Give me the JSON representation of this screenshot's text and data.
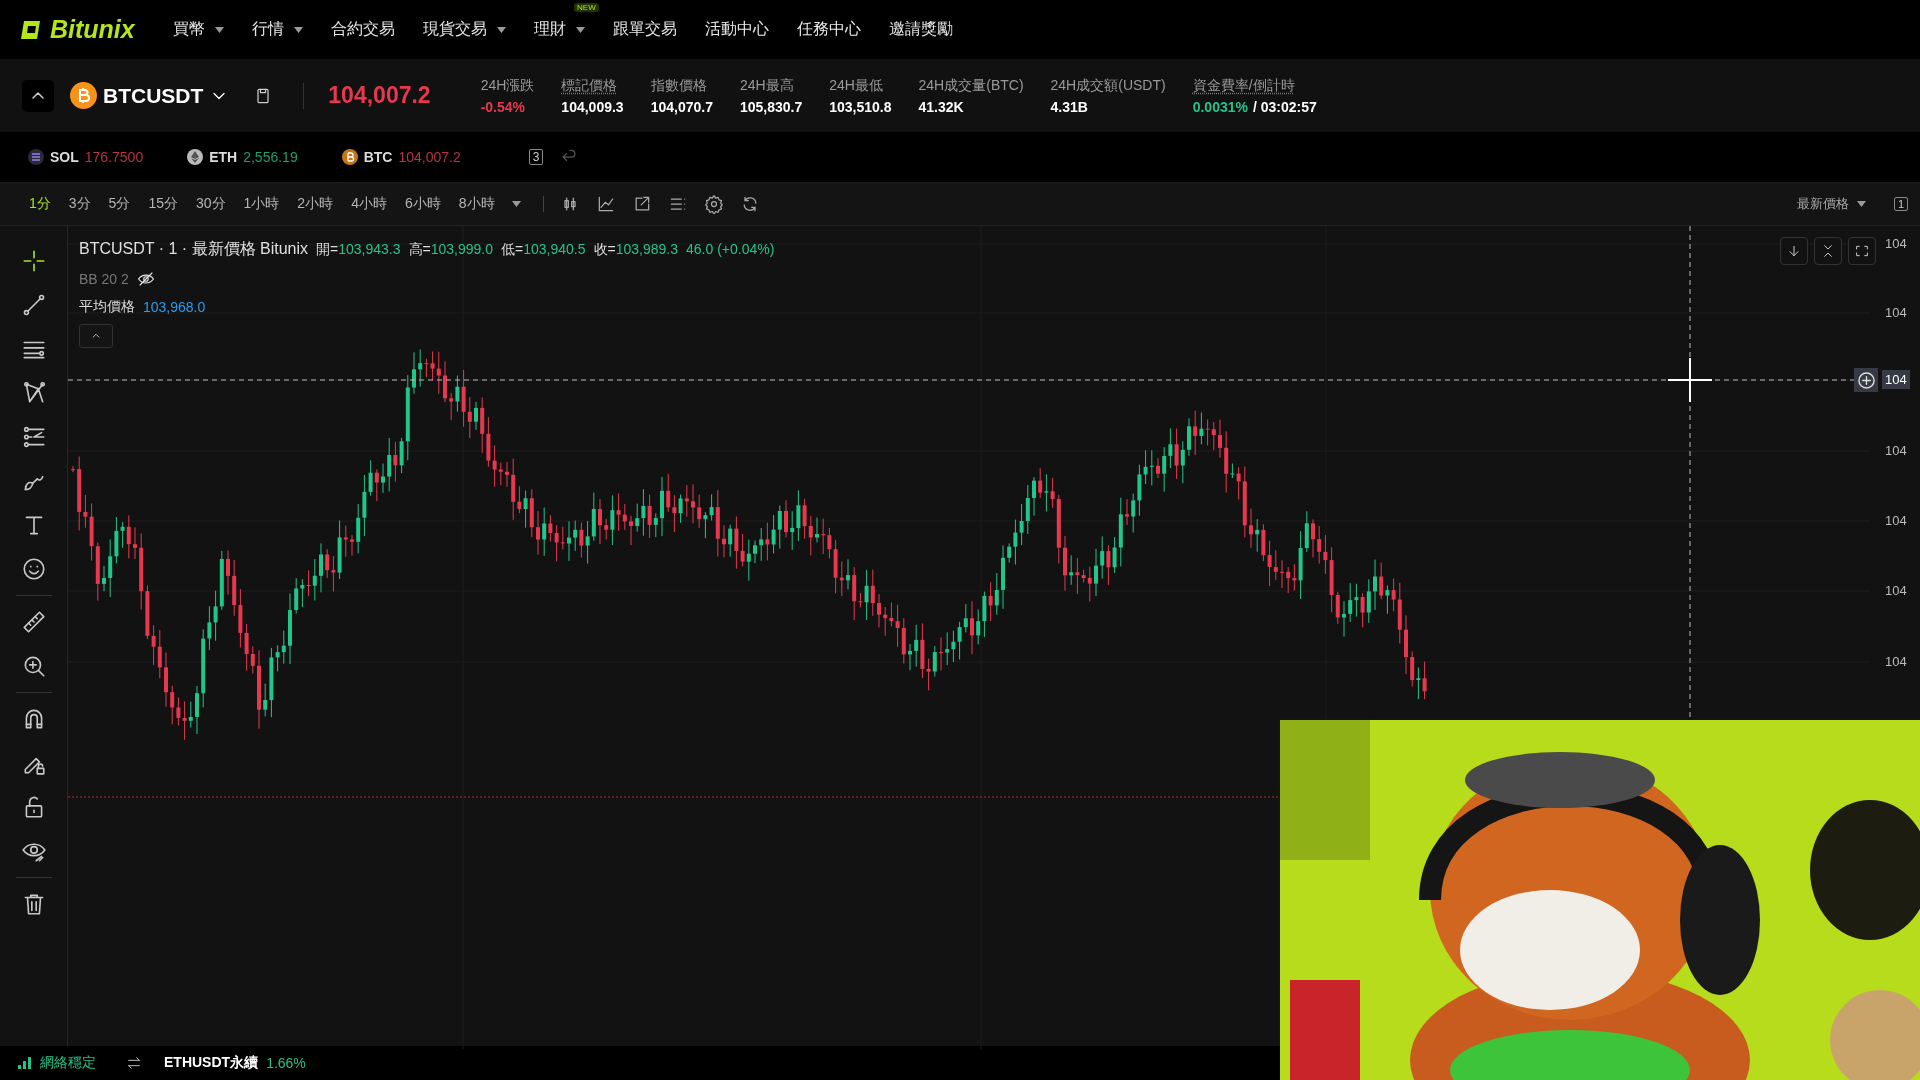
{
  "nav": {
    "logo": "Bitunix",
    "items": [
      {
        "label": "買幣",
        "dropdown": true
      },
      {
        "label": "行情",
        "dropdown": true
      },
      {
        "label": "合約交易",
        "dropdown": false
      },
      {
        "label": "現貨交易",
        "dropdown": true
      },
      {
        "label": "理財",
        "dropdown": true,
        "badge": "NEW"
      },
      {
        "label": "跟單交易",
        "dropdown": false
      },
      {
        "label": "活動中心",
        "dropdown": false
      },
      {
        "label": "任務中心",
        "dropdown": false
      },
      {
        "label": "邀請獎勵",
        "dropdown": false
      }
    ]
  },
  "ticker": {
    "symbol": "BTCUSDT",
    "price": {
      "value": "104,007.2",
      "color": "#e8384f"
    },
    "stats": [
      {
        "label": "24H漲跌",
        "value": "-0.54%",
        "color": "#e8384f",
        "underlined": false
      },
      {
        "label": "標記價格",
        "value": "104,009.3",
        "underlined": true
      },
      {
        "label": "指數價格",
        "value": "104,070.7",
        "underlined": false
      },
      {
        "label": "24H最高",
        "value": "105,830.7",
        "underlined": false
      },
      {
        "label": "24H最低",
        "value": "103,510.8",
        "underlined": false
      },
      {
        "label": "24H成交量(BTC)",
        "value": "41.32K",
        "underlined": false
      },
      {
        "label": "24H成交額(USDT)",
        "value": "4.31B",
        "underlined": false
      },
      {
        "label": "資金費率/倒計時",
        "value": "0.0031%",
        "color": "#22c58b",
        "suffix": "/ 03:02:57",
        "underlined": true
      }
    ]
  },
  "favorites": {
    "items": [
      {
        "symbol": "SOL",
        "price": "176.7500",
        "color": "#b8323f",
        "kind": "sol"
      },
      {
        "symbol": "ETH",
        "price": "2,556.19",
        "color": "#1f9e6e",
        "kind": "eth"
      },
      {
        "symbol": "BTC",
        "price": "104,007.2",
        "color": "#b8323f",
        "kind": "btc"
      }
    ],
    "layout_count": "3"
  },
  "toolbar": {
    "intervals": [
      {
        "label": "1分",
        "selected": true
      },
      {
        "label": "3分",
        "selected": false
      },
      {
        "label": "5分",
        "selected": false
      },
      {
        "label": "15分",
        "selected": false
      },
      {
        "label": "30分",
        "selected": false
      },
      {
        "label": "1小時",
        "selected": false
      },
      {
        "label": "2小時",
        "selected": false
      },
      {
        "label": "4小時",
        "selected": false
      },
      {
        "label": "6小時",
        "selected": false
      },
      {
        "label": "8小時",
        "selected": false
      }
    ],
    "price_type": "最新價格",
    "layout_count": "1"
  },
  "drawing_tools": [
    [
      {
        "kind": "crosshair",
        "selected": true
      },
      {
        "kind": "trend-line",
        "selected": false
      },
      {
        "kind": "horizontal-lines",
        "selected": false
      },
      {
        "kind": "pattern",
        "selected": false
      },
      {
        "kind": "fib",
        "selected": false
      },
      {
        "kind": "brush",
        "selected": false
      },
      {
        "kind": "text",
        "selected": false
      },
      {
        "kind": "emoji",
        "selected": false
      }
    ],
    [
      {
        "kind": "ruler",
        "selected": false
      },
      {
        "kind": "zoom",
        "selected": false
      }
    ],
    [
      {
        "kind": "magnet",
        "selected": false
      },
      {
        "kind": "pencil-lock",
        "selected": false
      },
      {
        "kind": "lock",
        "selected": false
      },
      {
        "kind": "eye",
        "selected": false
      }
    ],
    [
      {
        "kind": "trash",
        "selected": false
      }
    ]
  ],
  "chart": {
    "title": "BTCUSDT · 1 · 最新價格 Bitunix",
    "ohlc": [
      {
        "key": "開=",
        "value": "103,943.3"
      },
      {
        "key": "高=",
        "value": "103,999.0"
      },
      {
        "key": "低=",
        "value": "103,940.5"
      },
      {
        "key": "收=",
        "value": "103,989.3"
      }
    ],
    "change": "46.0 (+0.04%)",
    "indicator": {
      "label": "BB 20 2",
      "visible": false
    },
    "average": {
      "label": "平均價格",
      "value": "103,968.0"
    },
    "y_labels": [
      {
        "label": "104",
        "highlighted": false
      },
      {
        "label": "104",
        "highlighted": false
      },
      {
        "label": "104",
        "highlighted": true
      },
      {
        "label": "104",
        "highlighted": false
      },
      {
        "label": "104",
        "highlighted": false
      },
      {
        "label": "104",
        "highlighted": false
      },
      {
        "label": "104",
        "highlighted": false
      }
    ]
  },
  "status_bar": {
    "network": "網絡穩定",
    "pair": "ETHUSDT永續",
    "change": {
      "value": "1.66%",
      "color": "#22c58b"
    }
  },
  "video": {
    "kind": "picture"
  }
}
